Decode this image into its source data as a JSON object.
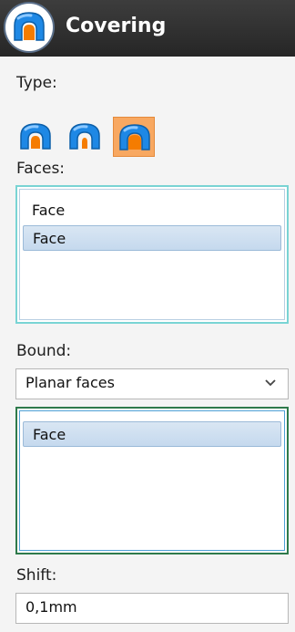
{
  "title_bar": {
    "title": "Covering",
    "icon": "covering-icon"
  },
  "type_section": {
    "label": "Type:",
    "buttons": [
      {
        "name": "type-option-1",
        "icon": "covering-type-1-icon",
        "selected": false
      },
      {
        "name": "type-option-2",
        "icon": "covering-type-2-icon",
        "selected": false
      },
      {
        "name": "type-option-3",
        "icon": "covering-type-3-icon",
        "selected": true
      }
    ]
  },
  "faces_section": {
    "label": "Faces:",
    "items": [
      {
        "label": "Face",
        "selected": false
      },
      {
        "label": "Face",
        "selected": true
      }
    ]
  },
  "bound_section": {
    "label": "Bound:",
    "select_value": "Planar faces",
    "items": [
      {
        "label": "Face",
        "selected": true
      }
    ]
  },
  "shift_section": {
    "label": "Shift:",
    "value": "0,1mm"
  },
  "colors": {
    "title_bg": "#2f2f2f",
    "accent_blue": "#1e88e5",
    "accent_orange": "#f57c00",
    "selected_button_bg": "#f8a861",
    "list_selection": "#c5d9ee"
  }
}
